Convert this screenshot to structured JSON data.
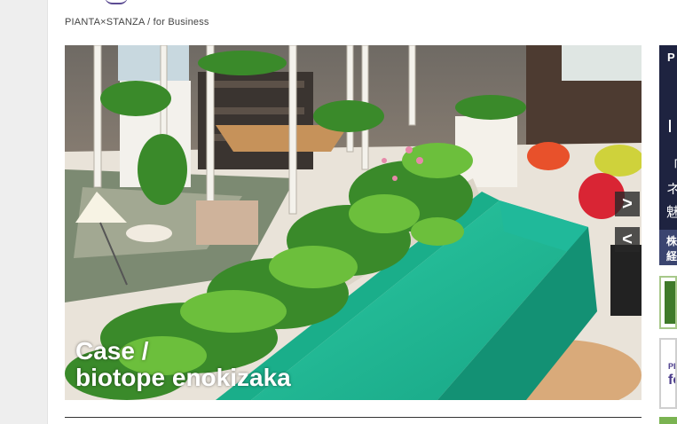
{
  "breadcrumb": "PIANTA×STANZA / for Business",
  "hero": {
    "caption_line1": "Case /",
    "caption_line2": "biotope enokizaka",
    "next_label": ">",
    "prev_label": "<"
  },
  "side": {
    "card1_label": "P",
    "card1_glyph1": "「ノ",
    "card1_glyph2": "ネ",
    "card1_glyph3": "魅",
    "card1_lower1": "株",
    "card1_lower2": "経",
    "card3_small": "PI",
    "card3_big": "fo"
  },
  "colors": {
    "sofa": "#1fb894",
    "accent_purple": "#5c4c93",
    "side_navy": "#1e2340",
    "side_green": "#7ab351"
  }
}
